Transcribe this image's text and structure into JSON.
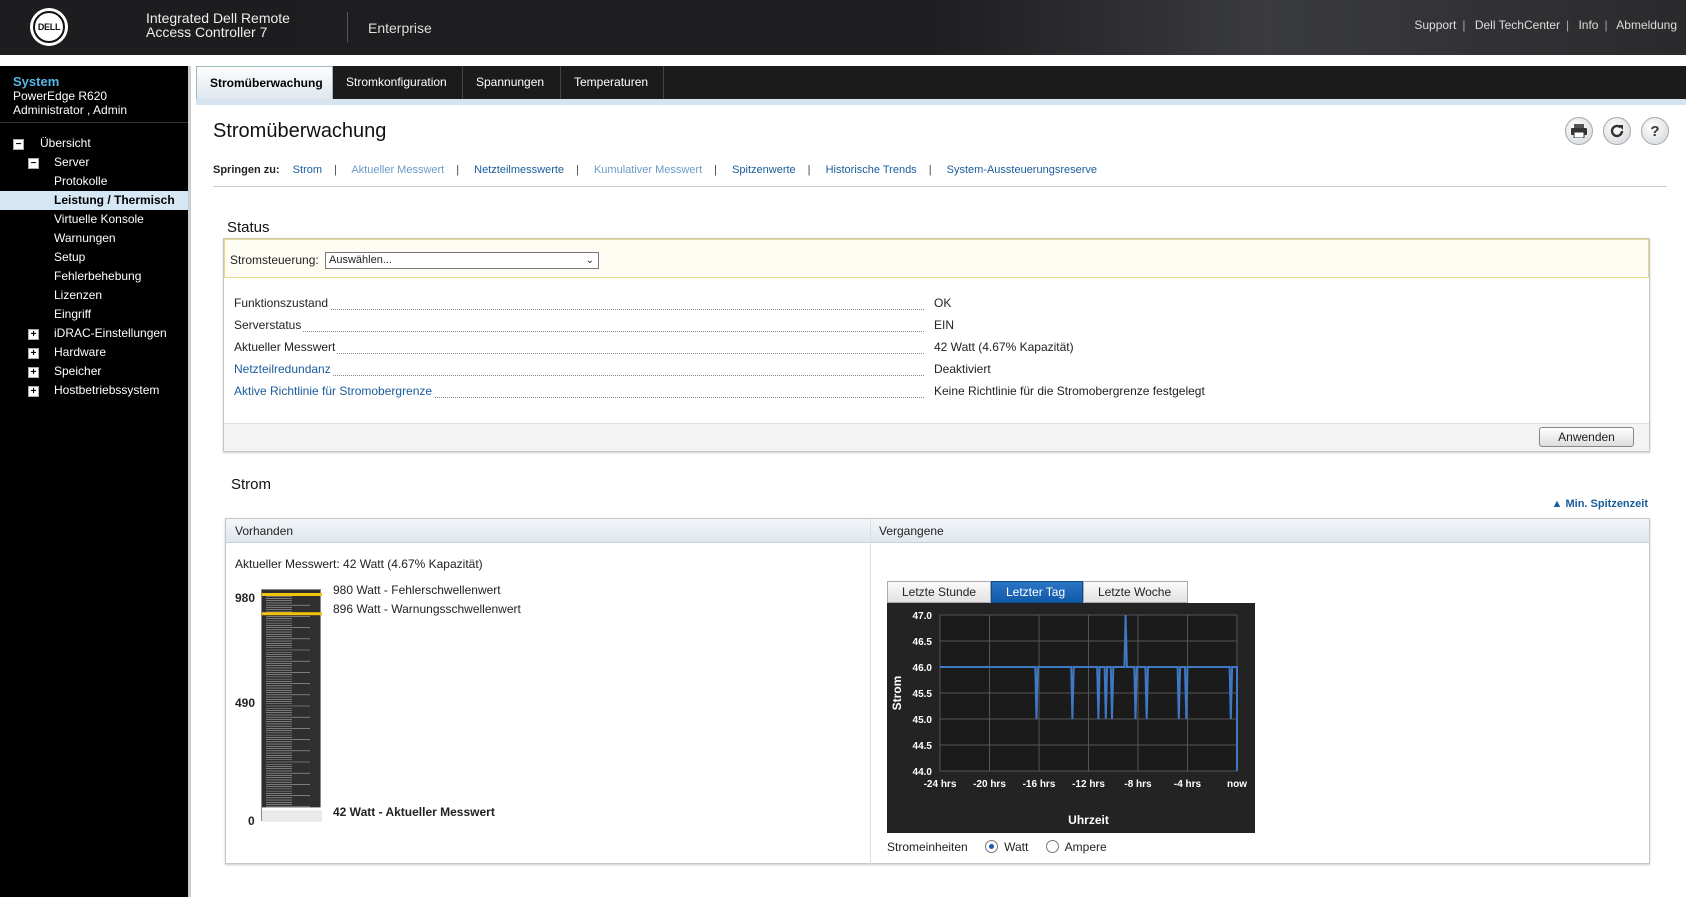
{
  "header": {
    "logo": "DELL",
    "product_line1": "Integrated Dell Remote",
    "product_line2": "Access Controller 7",
    "edition": "Enterprise",
    "links": [
      "Support",
      "Dell TechCenter",
      "Info",
      "Abmeldung"
    ]
  },
  "sidebar": {
    "title": "System",
    "model": "PowerEdge R620",
    "user": "Administrator , Admin",
    "tree": [
      {
        "label": "Übersicht",
        "toggle": "−"
      },
      {
        "label": "Server",
        "toggle": "−"
      },
      {
        "label": "Protokolle"
      },
      {
        "label": "Leistung / Thermisch",
        "selected": true
      },
      {
        "label": "Virtuelle Konsole"
      },
      {
        "label": "Warnungen"
      },
      {
        "label": "Setup"
      },
      {
        "label": "Fehlerbehebung"
      },
      {
        "label": "Lizenzen"
      },
      {
        "label": "Eingriff"
      },
      {
        "label": "iDRAC-Einstellungen",
        "toggle": "+"
      },
      {
        "label": "Hardware",
        "toggle": "+"
      },
      {
        "label": "Speicher",
        "toggle": "+"
      },
      {
        "label": "Hostbetriebssystem",
        "toggle": "+"
      }
    ]
  },
  "tabs": [
    "Stromüberwachung",
    "Stromkonfiguration",
    "Spannungen",
    "Temperaturen"
  ],
  "page": {
    "title": "Stromüberwachung",
    "icons": [
      "print-icon",
      "refresh-icon",
      "help-icon"
    ],
    "jump_label": "Springen zu:",
    "jump_links": [
      "Strom",
      "Aktueller Messwert",
      "Netzteilmesswerte",
      "Kumulativer Messwert",
      "Spitzenwerte",
      "Historische Trends",
      "System-Aussteuerungsreserve"
    ]
  },
  "status": {
    "heading": "Status",
    "control_label": "Stromsteuerung:",
    "control_value": "Auswählen...",
    "rows": [
      {
        "key": "Funktionszustand",
        "value": "OK"
      },
      {
        "key": "Serverstatus",
        "value": "EIN"
      },
      {
        "key": "Aktueller Messwert",
        "value": "42 Watt (4.67% Kapazität)"
      },
      {
        "key": "Netzteilredundanz",
        "value": "Deaktiviert"
      },
      {
        "key": "Aktive Richtlinie für Stromobergrenze",
        "value": "Keine Richtlinie für die Stromobergrenze festgelegt"
      }
    ],
    "apply": "Anwenden"
  },
  "power": {
    "heading": "Strom",
    "min_peak": "▲ Min. Spitzenzeit",
    "col_present": "Vorhanden",
    "col_past": "Vergangene",
    "current_text": "Aktueller Messwert: 42 Watt (4.67% Kapazität)",
    "gauge": {
      "max": 980,
      "mid": 490,
      "min": 0,
      "failure": 980,
      "warning": 896,
      "current": 42,
      "failure_text": "980 Watt - Fehlerschwellenwert",
      "warning_text": "896 Watt - Warnungsschwellenwert",
      "current_text": "42 Watt - Aktueller Messwert"
    },
    "chart_tabs": [
      "Letzte Stunde",
      "Letzter Tag",
      "Letzte Woche"
    ],
    "active_tab": 1,
    "units_label": "Stromeinheiten",
    "unit_options": [
      "Watt",
      "Ampere"
    ],
    "unit_selected": 0
  },
  "chart_data": {
    "type": "line",
    "xlabel": "Uhrzeit",
    "ylabel": "Strom",
    "x_ticks": [
      "-24 hrs",
      "-20 hrs",
      "-16 hrs",
      "-12 hrs",
      "-8 hrs",
      "-4 hrs",
      "now"
    ],
    "y_ticks": [
      "44.0",
      "44.5",
      "45.0",
      "45.5",
      "46.0",
      "46.5",
      "47.0"
    ],
    "xlim": [
      -24,
      0
    ],
    "ylim": [
      44.0,
      47.0
    ],
    "grid": true,
    "line_color": "#3f78c4",
    "series": [
      {
        "values": [
          [
            -24,
            46
          ],
          [
            -16.3,
            46
          ],
          [
            -16.2,
            45
          ],
          [
            -16.1,
            46
          ],
          [
            -13.4,
            46
          ],
          [
            -13.3,
            45
          ],
          [
            -13.2,
            46
          ],
          [
            -11.3,
            46
          ],
          [
            -11.2,
            45
          ],
          [
            -11.1,
            46
          ],
          [
            -10.7,
            46
          ],
          [
            -10.6,
            45
          ],
          [
            -10.5,
            46
          ],
          [
            -10.2,
            46
          ],
          [
            -10.1,
            45
          ],
          [
            -10.0,
            46
          ],
          [
            -9.1,
            46
          ],
          [
            -9.0,
            47
          ],
          [
            -8.9,
            46
          ],
          [
            -8.3,
            46
          ],
          [
            -8.2,
            45
          ],
          [
            -8.1,
            46
          ],
          [
            -7.4,
            46
          ],
          [
            -7.3,
            45
          ],
          [
            -7.2,
            46
          ],
          [
            -4.8,
            46
          ],
          [
            -4.7,
            45
          ],
          [
            -4.6,
            46
          ],
          [
            -4.2,
            46
          ],
          [
            -4.1,
            45
          ],
          [
            -4.0,
            46
          ],
          [
            -0.6,
            46
          ],
          [
            -0.5,
            45
          ],
          [
            -0.4,
            46
          ],
          [
            0,
            46
          ],
          [
            0,
            44
          ]
        ]
      }
    ]
  }
}
